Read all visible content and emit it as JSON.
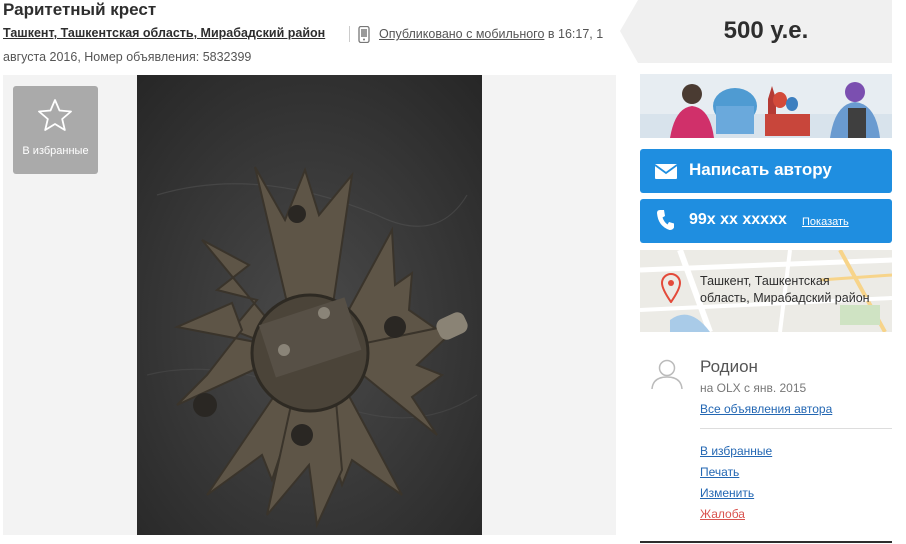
{
  "listing": {
    "title": "Раритетный крест",
    "location": "Ташкент, Ташкентская область, Мирабадский район",
    "published_link": "Опубликовано с мобильного",
    "published_time": " в 16:17, 1",
    "published_line2": "августа 2016, Номер объявления: 5832399"
  },
  "price": "500 у.е.",
  "gallery": {
    "favorite_label": "В избранные"
  },
  "contact": {
    "write_label": "Написать автору",
    "phone_number": "99x xx xxxxx",
    "show_label": "Показать",
    "map_location": "Ташкент, Ташкентская область, Мирабадский район"
  },
  "seller": {
    "name": "Родион",
    "since": "на OLX с янв. 2015",
    "all_ads": "Все объявления автора"
  },
  "actions": {
    "favorite": "В избранные",
    "print": "Печать",
    "edit": "Изменить",
    "report": "Жалоба"
  },
  "colors": {
    "accent": "#1f8ee0",
    "link": "#2367b3",
    "report": "#d9534f",
    "price_bg": "#f0f0f0"
  }
}
